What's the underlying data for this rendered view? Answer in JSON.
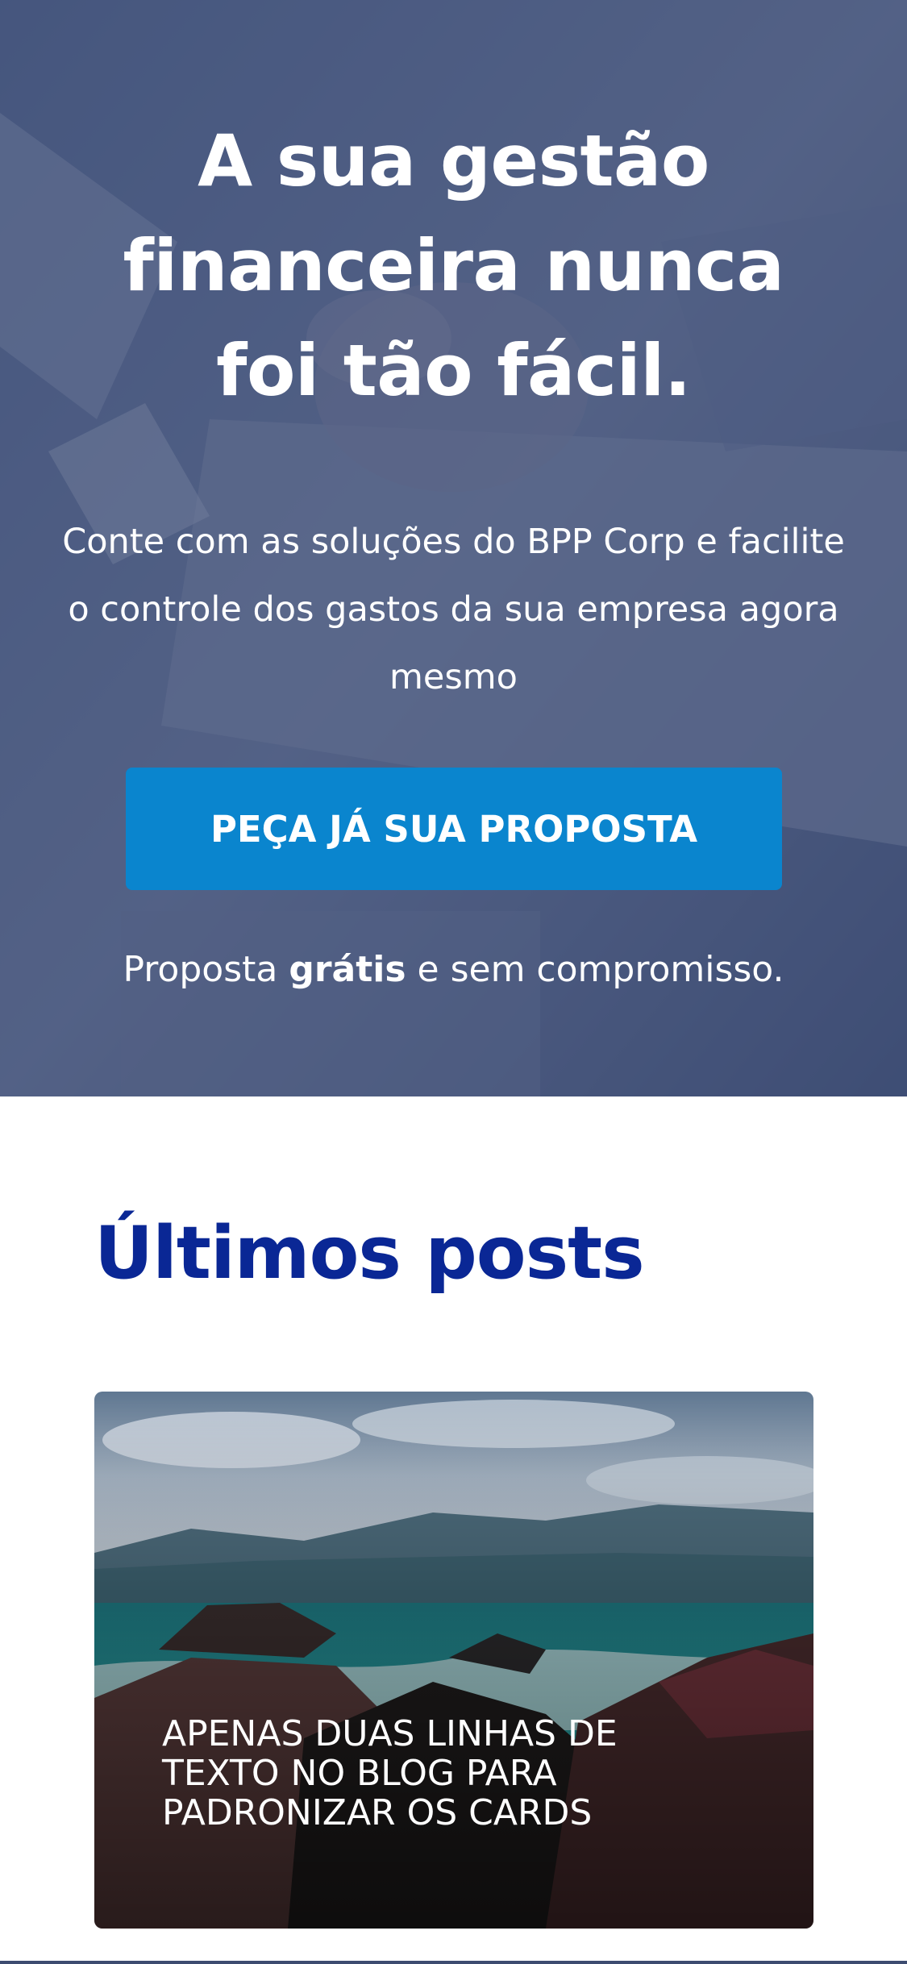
{
  "hero": {
    "title": "A sua gestão financeira nunca foi tão fácil.",
    "subtitle": "Conte com as soluções do BPP Corp e facilite o controle dos gastos da sua empresa agora mesmo",
    "cta_label": "PEÇA JÁ SUA PROPOSTA",
    "note_prefix": "Proposta ",
    "note_bold": "grátis",
    "note_suffix": " e sem compromisso."
  },
  "posts": {
    "section_title": "Últimos posts",
    "items": [
      {
        "title": "APENAS DUAS LINHAS DE TEXTO NO BLOG PARA PADRONIZAR OS CARDS"
      }
    ]
  },
  "colors": {
    "hero_overlay": "#3d4b70",
    "cta": "#0a85ce",
    "posts_title": "#0a2795"
  }
}
